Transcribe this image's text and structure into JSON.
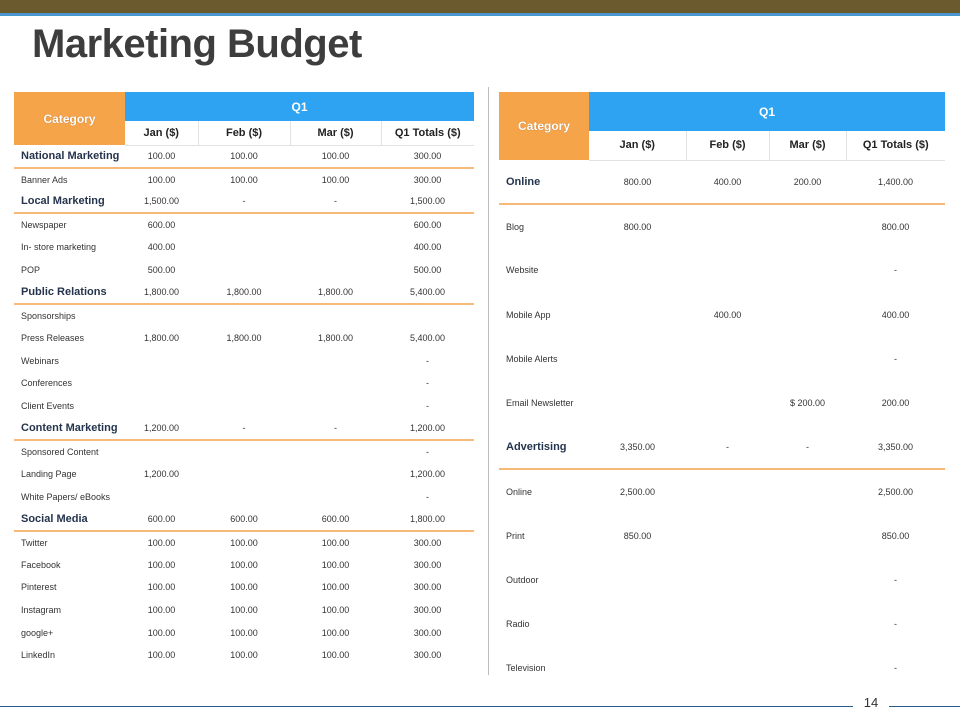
{
  "slide": {
    "title": "Marketing Budget",
    "page_number": "14"
  },
  "colors": {
    "top_bar": "#6b5a2e",
    "top_line": "#4a96cf",
    "category_header": "#f6a44a",
    "quarter_header": "#2ea3f2",
    "group_rule": "#f6b978"
  },
  "left_table": {
    "header": {
      "category": "Category",
      "quarter": "Q1",
      "columns": [
        "Jan  ($)",
        "Feb ($)",
        "Mar ($)",
        "Q1 Totals ($)"
      ]
    },
    "rows": [
      {
        "label": "National Marketing",
        "group": true,
        "cells": [
          "100.00",
          "100.00",
          "100.00",
          "300.00"
        ]
      },
      {
        "label": "Banner Ads",
        "group": false,
        "cells": [
          "100.00",
          "100.00",
          "100.00",
          "300.00"
        ]
      },
      {
        "label": "Local Marketing",
        "group": true,
        "cells": [
          "1,500.00",
          "-",
          "-",
          "1,500.00"
        ]
      },
      {
        "label": "Newspaper",
        "group": false,
        "cells": [
          "600.00",
          "",
          "",
          "600.00"
        ]
      },
      {
        "label": "In- store marketing",
        "group": false,
        "cells": [
          "400.00",
          "",
          "",
          "400.00"
        ]
      },
      {
        "label": "POP",
        "group": false,
        "cells": [
          "500.00",
          "",
          "",
          "500.00"
        ]
      },
      {
        "label": "Public Relations",
        "group": true,
        "cells": [
          "1,800.00",
          "1,800.00",
          "1,800.00",
          "5,400.00"
        ]
      },
      {
        "label": "Sponsorships",
        "group": false,
        "cells": [
          "",
          "",
          "",
          ""
        ]
      },
      {
        "label": "Press Releases",
        "group": false,
        "cells": [
          "1,800.00",
          "1,800.00",
          "1,800.00",
          "5,400.00"
        ]
      },
      {
        "label": "Webinars",
        "group": false,
        "cells": [
          "",
          "",
          "",
          "-"
        ]
      },
      {
        "label": "Conferences",
        "group": false,
        "cells": [
          "",
          "",
          "",
          "-"
        ]
      },
      {
        "label": "Client Events",
        "group": false,
        "cells": [
          "",
          "",
          "",
          "-"
        ]
      },
      {
        "label": "Content Marketing",
        "group": true,
        "cells": [
          "1,200.00",
          "-",
          "-",
          "1,200.00"
        ]
      },
      {
        "label": "Sponsored Content",
        "group": false,
        "cells": [
          "",
          "",
          "",
          "-"
        ]
      },
      {
        "label": "Landing Page",
        "group": false,
        "cells": [
          "1,200.00",
          "",
          "",
          "1,200.00"
        ]
      },
      {
        "label": "White Papers/ eBooks",
        "group": false,
        "cells": [
          "",
          "",
          "",
          "-"
        ]
      },
      {
        "label": "Social Media",
        "group": true,
        "cells": [
          "600.00",
          "600.00",
          "600.00",
          "1,800.00"
        ]
      },
      {
        "label": "Twitter",
        "group": false,
        "cells": [
          "100.00",
          "100.00",
          "100.00",
          "300.00"
        ]
      },
      {
        "label": "Facebook",
        "group": false,
        "cells": [
          "100.00",
          "100.00",
          "100.00",
          "300.00"
        ]
      },
      {
        "label": "Pinterest",
        "group": false,
        "cells": [
          "100.00",
          "100.00",
          "100.00",
          "300.00"
        ]
      },
      {
        "label": "Instagram",
        "group": false,
        "cells": [
          "100.00",
          "100.00",
          "100.00",
          "300.00"
        ]
      },
      {
        "label": "google+",
        "group": false,
        "cells": [
          "100.00",
          "100.00",
          "100.00",
          "300.00"
        ]
      },
      {
        "label": "LinkedIn",
        "group": false,
        "cells": [
          "100.00",
          "100.00",
          "100.00",
          "300.00"
        ]
      }
    ]
  },
  "right_table": {
    "header": {
      "category": "Category",
      "quarter": "Q1",
      "columns": [
        "Jan ($)",
        "Feb ($)",
        "Mar ($)",
        "Q1 Totals ($)"
      ]
    },
    "rows": [
      {
        "label": "Online",
        "group": true,
        "cells": [
          "800.00",
          "400.00",
          "200.00",
          "1,400.00"
        ]
      },
      {
        "label": "Blog",
        "group": false,
        "cells": [
          "800.00",
          "",
          "",
          "800.00"
        ]
      },
      {
        "label": "Website",
        "group": false,
        "cells": [
          "",
          "",
          "",
          "-"
        ]
      },
      {
        "label": "Mobile App",
        "group": false,
        "cells": [
          "",
          "400.00",
          "",
          "400.00"
        ]
      },
      {
        "label": "Mobile Alerts",
        "group": false,
        "cells": [
          "",
          "",
          "",
          "-"
        ]
      },
      {
        "label": "Email Newsletter",
        "group": false,
        "cells": [
          "",
          "",
          "$ 200.00",
          "200.00"
        ]
      },
      {
        "label": "Advertising",
        "group": true,
        "cells": [
          "3,350.00",
          "-",
          "-",
          "3,350.00"
        ]
      },
      {
        "label": "Online",
        "group": false,
        "cells": [
          "2,500.00",
          "",
          "",
          "2,500.00"
        ]
      },
      {
        "label": "Print",
        "group": false,
        "cells": [
          "850.00",
          "",
          "",
          "850.00"
        ]
      },
      {
        "label": "Outdoor",
        "group": false,
        "cells": [
          "",
          "",
          "",
          "-"
        ]
      },
      {
        "label": "Radio",
        "group": false,
        "cells": [
          "",
          "",
          "",
          "-"
        ]
      },
      {
        "label": "Television",
        "group": false,
        "cells": [
          "",
          "",
          "",
          "-"
        ]
      }
    ]
  }
}
